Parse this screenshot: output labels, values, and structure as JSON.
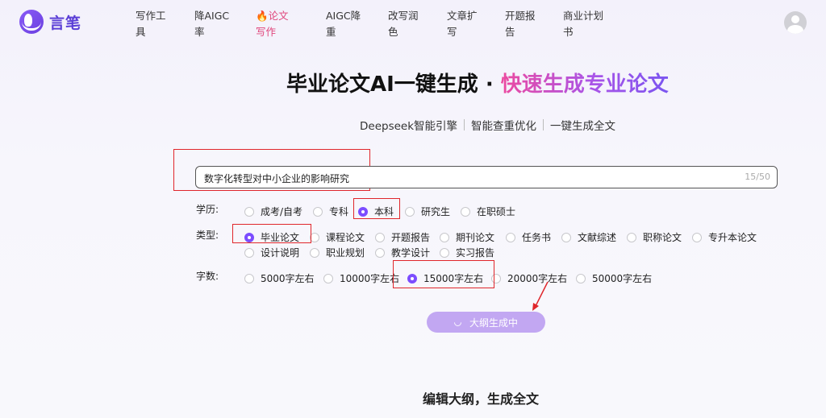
{
  "logo": {
    "text": "言笔"
  },
  "nav": {
    "items": [
      {
        "label": "写作工具",
        "active": false
      },
      {
        "label": "降AIGC率",
        "active": false
      },
      {
        "label": "论文写作",
        "active": true,
        "icon": "fire-icon"
      },
      {
        "label": "AIGC降重",
        "active": false
      },
      {
        "label": "改写润色",
        "active": false
      },
      {
        "label": "文章扩写",
        "active": false
      },
      {
        "label": "开题报告",
        "active": false
      },
      {
        "label": "商业计划书",
        "active": false
      }
    ],
    "fire_glyph": "🔥"
  },
  "hero": {
    "title_main": "毕业论文AI一键生成 · ",
    "title_highlight": "快速生成专业论文",
    "features": [
      "Deepseek智能引擎",
      "智能查重优化",
      "一键生成全文"
    ]
  },
  "topic": {
    "value": "数字化转型对中小企业的影响研究",
    "count": "15/50"
  },
  "education": {
    "label": "学历:",
    "options": [
      "成考/自考",
      "专科",
      "本科",
      "研究生",
      "在职硕士"
    ],
    "selected": "本科"
  },
  "paper_type": {
    "label": "类型:",
    "options": [
      "毕业论文",
      "课程论文",
      "开题报告",
      "期刊论文",
      "任务书",
      "文献综述",
      "职称论文",
      "专升本论文",
      "设计说明",
      "职业规划",
      "教学设计",
      "实习报告"
    ],
    "selected": "毕业论文"
  },
  "word_count": {
    "label": "字数:",
    "options": [
      "5000字左右",
      "10000字左右",
      "15000字左右",
      "20000字左右",
      "50000字左右"
    ],
    "selected": "15000字左右"
  },
  "generate_button": {
    "label": "大纲生成中"
  },
  "section": {
    "title": "编辑大纲，生成全文"
  },
  "colors": {
    "accent": "#7c4dff",
    "annotation_red": "#e0262b",
    "nav_active": "#e0457b"
  }
}
